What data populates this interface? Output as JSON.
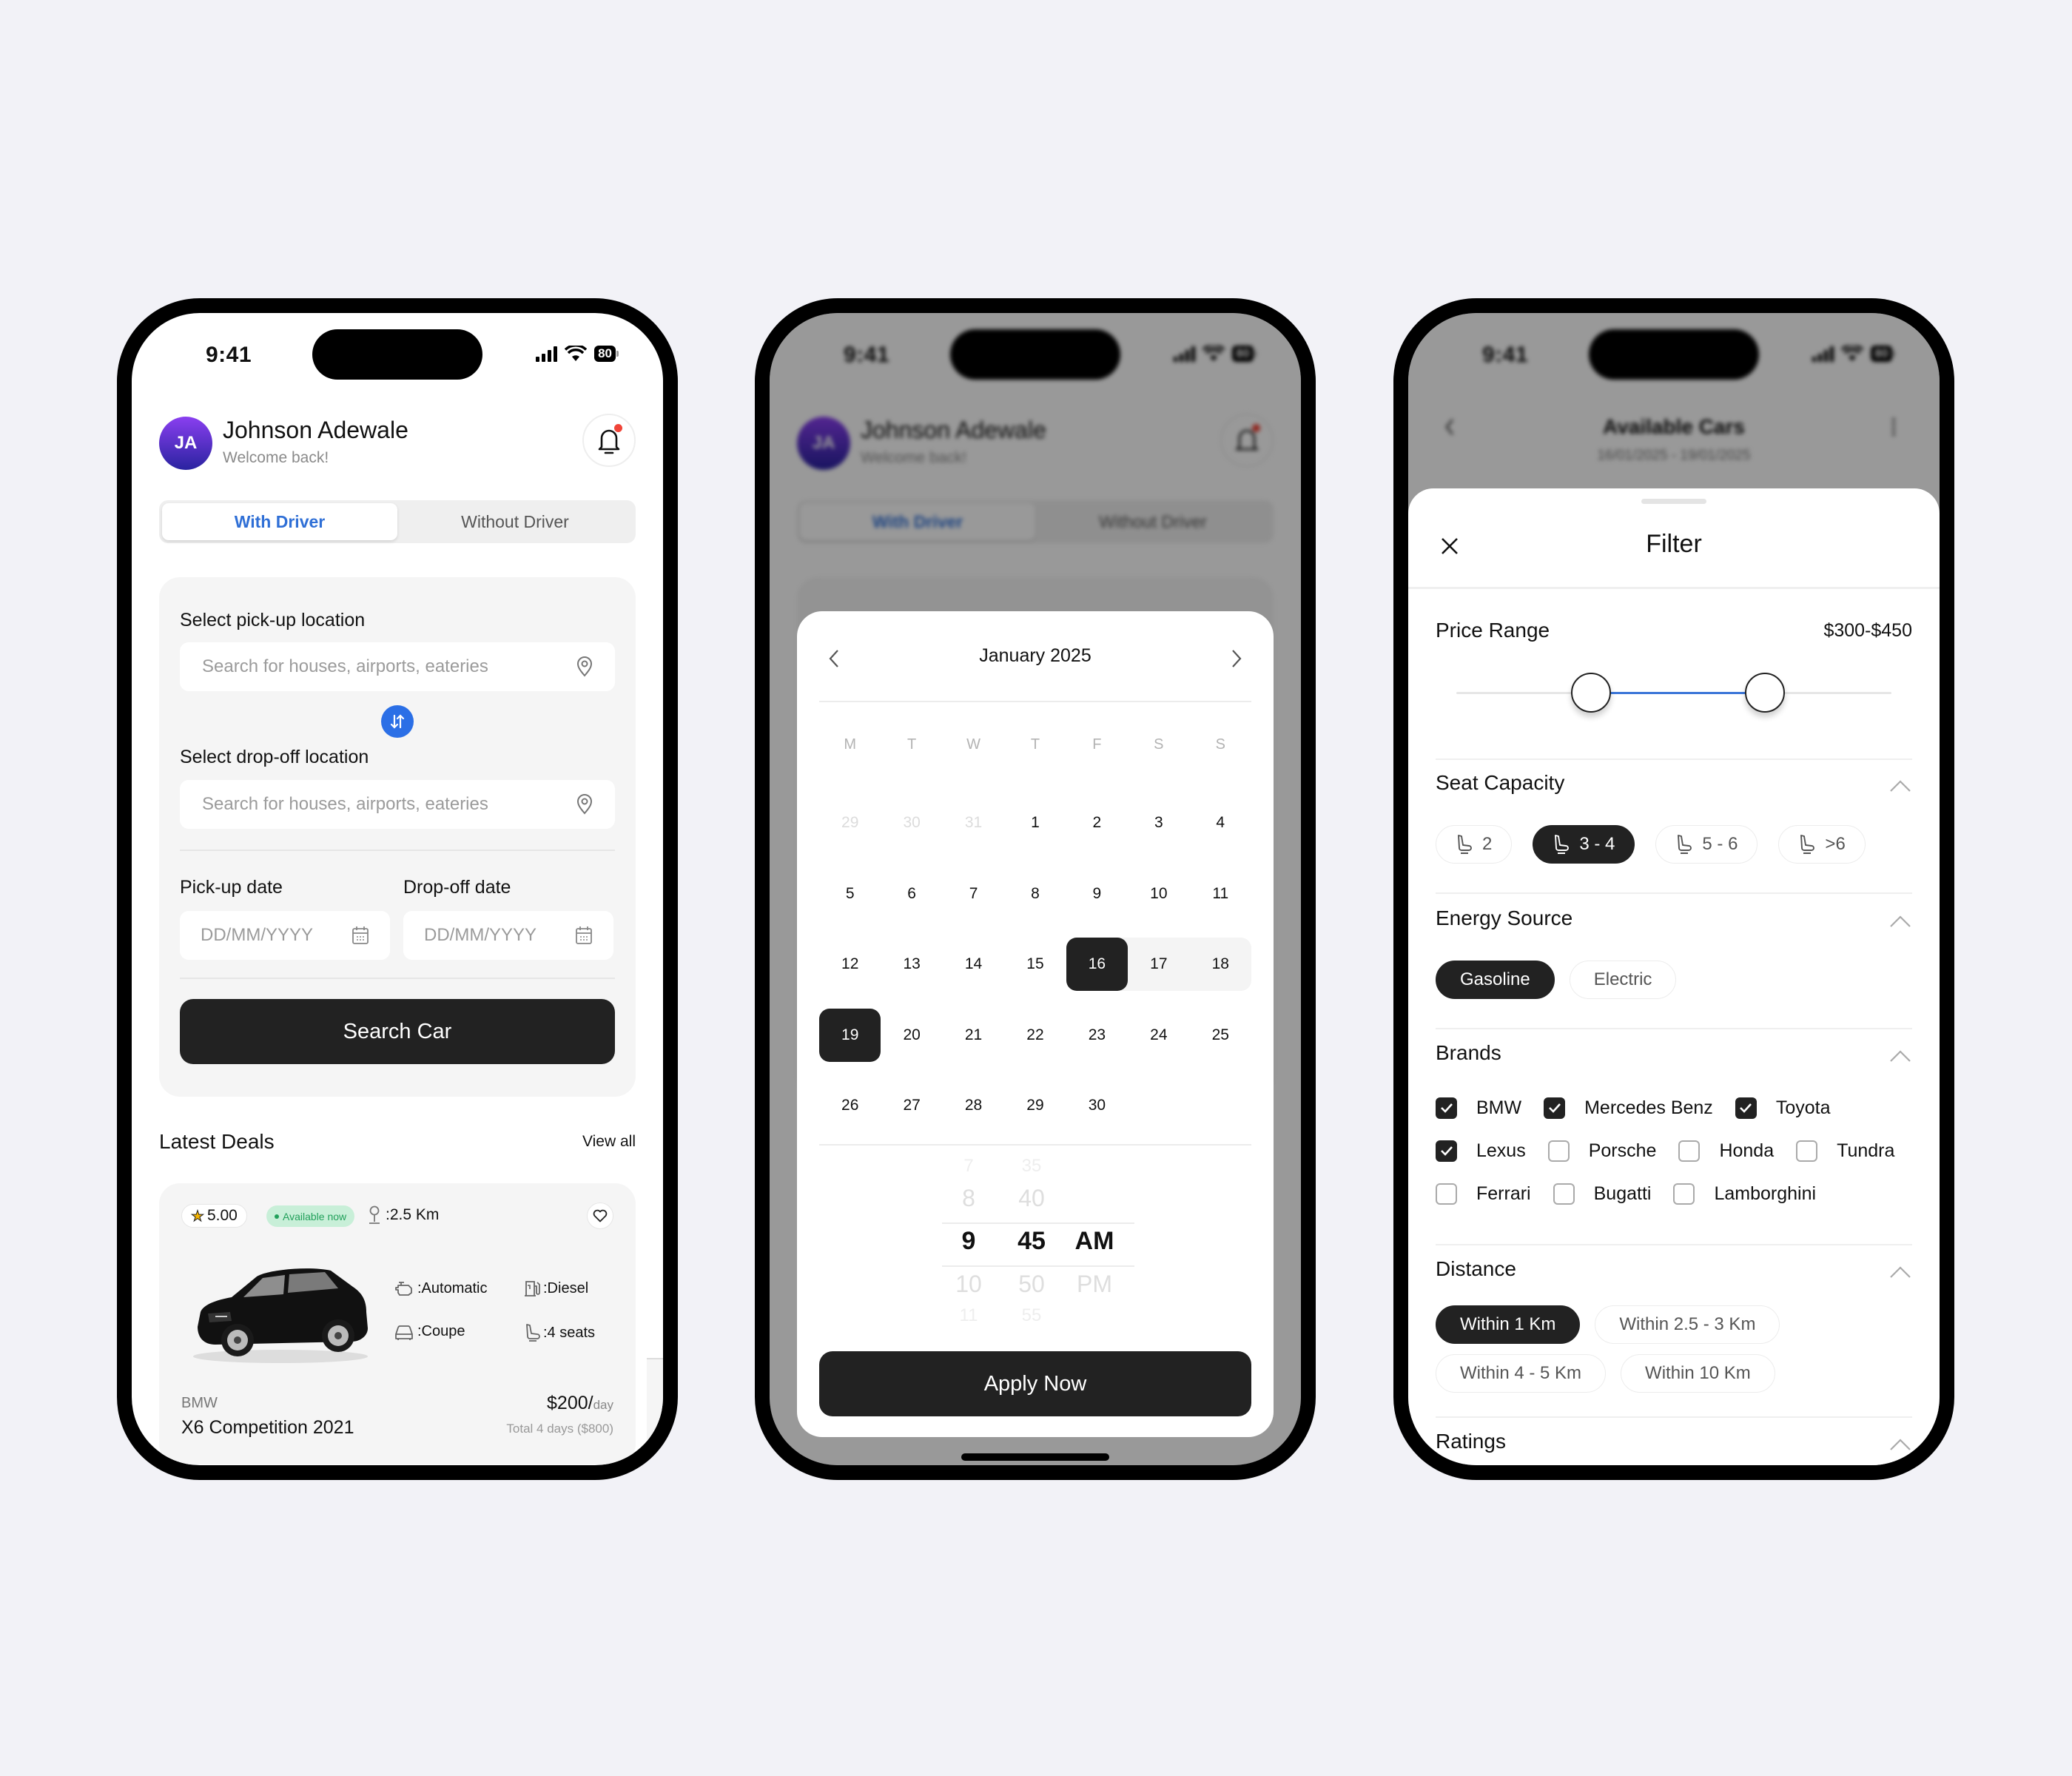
{
  "status_bar": {
    "time": "9:41",
    "battery": "80"
  },
  "home": {
    "user": {
      "initials": "JA",
      "name": "Johnson Adewale",
      "greeting": "Welcome back!"
    },
    "tabs": [
      {
        "label": "With Driver",
        "active": true
      },
      {
        "label": "Without Driver",
        "active": false
      }
    ],
    "pickup_label": "Select pick-up location",
    "pickup_placeholder": "Search for houses, airports, eateries",
    "dropoff_label": "Select drop-off location",
    "dropoff_placeholder": "Search for houses, airports, eateries",
    "pickup_date_label": "Pick-up date",
    "dropoff_date_label": "Drop-off date",
    "date_placeholder": "DD/MM/YYYY",
    "search_button": "Search Car",
    "deals_title": "Latest Deals",
    "view_all": "View all",
    "deal": {
      "rating": "5.00",
      "availability": "Available now",
      "distance": ":2.5 Km",
      "specs": {
        "transmission": ":Automatic",
        "fuel": ":Diesel",
        "body": ":Coupe",
        "seats": ":4 seats"
      },
      "brand": "BMW",
      "model": "X6 Competition 2021",
      "price": "$200/",
      "price_unit": "day",
      "total": "Total 4 days ($800)"
    },
    "accent_color": "#2f6fd6"
  },
  "calendar": {
    "month_title": "January 2025",
    "weekdays": [
      "M",
      "T",
      "W",
      "T",
      "F",
      "S",
      "S"
    ],
    "weeks": [
      [
        {
          "d": "29",
          "muted": true
        },
        {
          "d": "30",
          "muted": true
        },
        {
          "d": "31",
          "muted": true
        },
        {
          "d": "1"
        },
        {
          "d": "2"
        },
        {
          "d": "3"
        },
        {
          "d": "4"
        }
      ],
      [
        {
          "d": "5"
        },
        {
          "d": "6"
        },
        {
          "d": "7"
        },
        {
          "d": "8"
        },
        {
          "d": "9"
        },
        {
          "d": "10"
        },
        {
          "d": "11"
        }
      ],
      [
        {
          "d": "12"
        },
        {
          "d": "13"
        },
        {
          "d": "14"
        },
        {
          "d": "15"
        },
        {
          "d": "16",
          "selected": true
        },
        {
          "d": "17",
          "inrange": true
        },
        {
          "d": "18",
          "inrange": true
        }
      ],
      [
        {
          "d": "19",
          "selected": true
        },
        {
          "d": "20"
        },
        {
          "d": "21"
        },
        {
          "d": "22"
        },
        {
          "d": "23"
        },
        {
          "d": "24"
        },
        {
          "d": "25"
        }
      ],
      [
        {
          "d": "26"
        },
        {
          "d": "27"
        },
        {
          "d": "28"
        },
        {
          "d": "29"
        },
        {
          "d": "30"
        },
        {
          "d": ""
        },
        {
          "d": ""
        }
      ]
    ],
    "time": {
      "hours": [
        "7",
        "8",
        "9",
        "10",
        "11"
      ],
      "minutes": [
        "35",
        "40",
        "45",
        "50",
        "55"
      ],
      "period": [
        "",
        "",
        "AM",
        "PM",
        ""
      ],
      "selected_hour": "9",
      "selected_minute": "45",
      "selected_period": "AM"
    },
    "apply_button": "Apply Now"
  },
  "filter": {
    "background_title": "Available Cars",
    "background_dates": "16/01/2025 - 19/01/2025",
    "title": "Filter",
    "price_range": {
      "label": "Price Range",
      "value": "$300-$450",
      "low_fraction": 0.31,
      "high_fraction": 0.71
    },
    "seat_capacity": {
      "label": "Seat Capacity",
      "options": [
        {
          "label": "2"
        },
        {
          "label": "3 - 4",
          "active": true
        },
        {
          "label": "5 - 6"
        },
        {
          "label": ">6"
        }
      ]
    },
    "energy_source": {
      "label": "Energy Source",
      "options": [
        {
          "label": "Gasoline",
          "active": true
        },
        {
          "label": "Electric"
        }
      ]
    },
    "brands": {
      "label": "Brands",
      "rows": [
        [
          {
            "label": "BMW",
            "checked": true
          },
          {
            "label": "Mercedes Benz",
            "checked": true
          },
          {
            "label": "Toyota",
            "checked": true
          }
        ],
        [
          {
            "label": "Lexus",
            "checked": true
          },
          {
            "label": "Porsche"
          },
          {
            "label": "Honda"
          },
          {
            "label": "Tundra"
          }
        ],
        [
          {
            "label": "Ferrari"
          },
          {
            "label": "Bugatti"
          },
          {
            "label": "Lamborghini"
          }
        ]
      ]
    },
    "distance": {
      "label": "Distance",
      "options": [
        {
          "label": "Within 1 Km",
          "active": true
        },
        {
          "label": "Within 2.5 - 3 Km"
        },
        {
          "label": "Within 4 - 5 Km"
        },
        {
          "label": "Within 10 Km"
        }
      ]
    },
    "ratings": {
      "label": "Ratings"
    }
  }
}
